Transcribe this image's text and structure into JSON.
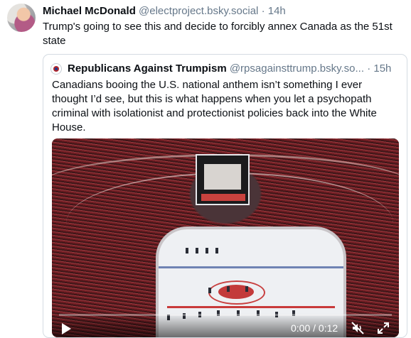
{
  "post": {
    "author_name": "Michael McDonald",
    "handle": "@electproject.bsky.social",
    "separator": "·",
    "time": "14h",
    "text": "Trump's going to see this and decide to forcibly annex Canada as the 51st state"
  },
  "quote": {
    "author_name": "Republicans Against Trumpism",
    "handle": "@rpsagainsttrump.bsky.so...",
    "separator": "·",
    "time": "15h",
    "text": "Canadians booing the U.S. national anthem isn’t something I ever thought I’d see, but this is what happens when you let a psychopath criminal with isolationist and protectionist policies back into the White House."
  },
  "video": {
    "time_readout": "0:00 / 0:12",
    "play_icon": "play-icon",
    "mute_icon": "speaker-muted-icon",
    "fullscreen_icon": "expand-icon"
  },
  "colors": {
    "muted_text": "#66788a",
    "border": "#d4dbe2",
    "text": "#0b0f14"
  }
}
